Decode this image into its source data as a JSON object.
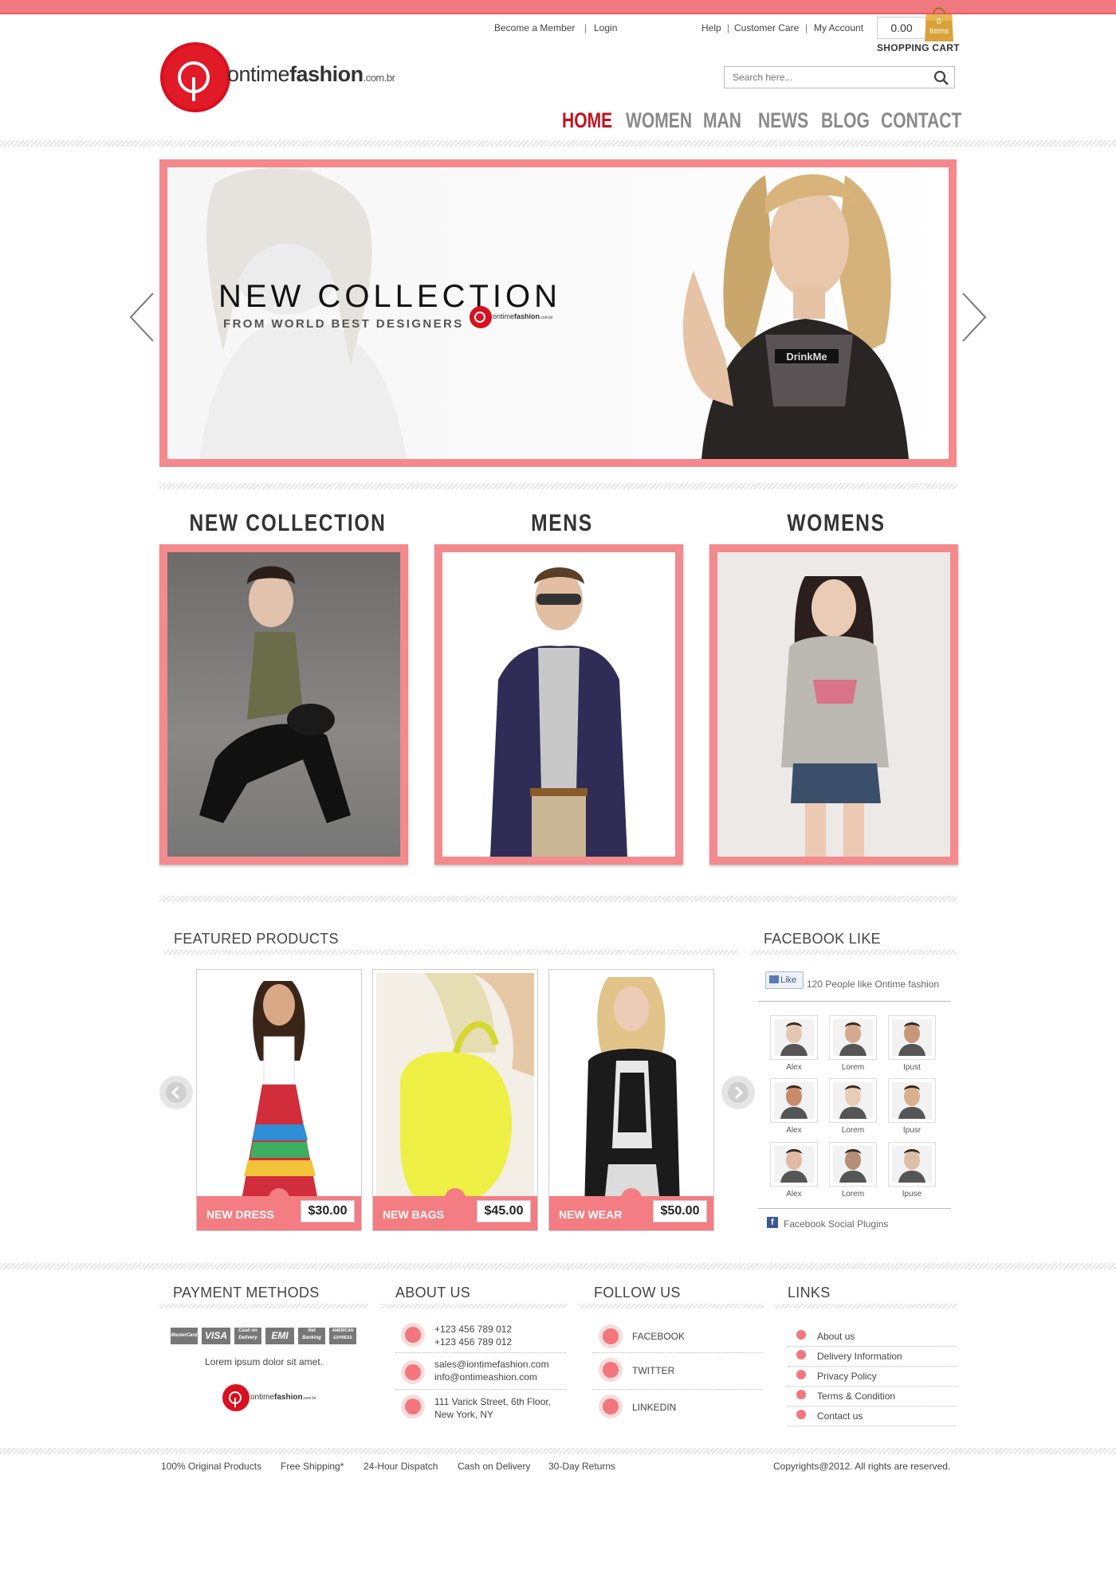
{
  "header": {
    "top_links_left": [
      "Become a Member",
      "Login"
    ],
    "top_links_right": [
      "Help",
      "Customer Care",
      "My Account"
    ],
    "cart": {
      "amount": "0.00",
      "items_count": "0",
      "items_label": "Items",
      "label": "SHOPPING CART"
    },
    "logo": {
      "part1": "on",
      "part2": "time",
      "part3": "fashion",
      "suffix": ".com.br"
    },
    "search_placeholder": "Search here...",
    "nav": [
      "HOME",
      "WOMEN",
      "MAN",
      "NEWS",
      "BLOG",
      "CONTACT"
    ]
  },
  "hero": {
    "title": "NEW COLLECTION",
    "subtitle": "FROM WORLD BEST DESIGNERS",
    "shirt_text": "DrinkMe"
  },
  "categories": [
    "NEW COLLECTION",
    "MENS",
    "WOMENS"
  ],
  "featured": {
    "title": "FEATURED PRODUCTS",
    "products": [
      {
        "name": "NEW DRESS",
        "price": "$30.00"
      },
      {
        "name": "NEW BAGS",
        "price": "$45.00"
      },
      {
        "name": "NEW WEAR",
        "price": "$50.00"
      }
    ]
  },
  "facebook": {
    "title": "FACEBOOK LIKE",
    "like_button": "Like",
    "like_text": "120 People like Ontime fashion",
    "fans": [
      "Alex",
      "Lorem",
      "Ipust",
      "Alex",
      "Lorem",
      "Ipusr",
      "Alex",
      "Lorem",
      "Ipuse"
    ],
    "plugin_text": "Facebook Social Plugins"
  },
  "footer": {
    "payment": {
      "title": "PAYMENT METHODS",
      "cards": [
        "MasterCard",
        "VISA",
        "Cash on Delivery",
        "EMI",
        "Net Banking",
        "AMERICAN EXPRESS"
      ],
      "text": "Lorem ipsum dolor sit amet."
    },
    "about": {
      "title": "ABOUT US",
      "phone1": "+123 456 789 012",
      "phone2": "+123 456 789 012",
      "email1": "sales@iontimefashion.com",
      "email2": "info@ontimeashion.com",
      "address1": "111 Varick Street, 6th Floor,",
      "address2": "New York, NY"
    },
    "follow": {
      "title": "FOLLOW US",
      "items": [
        "FACEBOOK",
        "TWITTER",
        "LINKEDIN"
      ]
    },
    "links": {
      "title": "LINKS",
      "items": [
        "About us",
        "Delivery Information",
        "Privacy Policy",
        "Terms & Condition",
        "Contact us"
      ]
    }
  },
  "bottom": {
    "features": [
      "100% Original Products",
      "Free Shipping*",
      "24-Hour Dispatch",
      "Cash on Delivery",
      "30-Day Returns"
    ],
    "copyright": "Copyrights@2012. All rights are reserved."
  },
  "colors": {
    "accent": "#f37d82",
    "brand_red": "#c1121f"
  }
}
